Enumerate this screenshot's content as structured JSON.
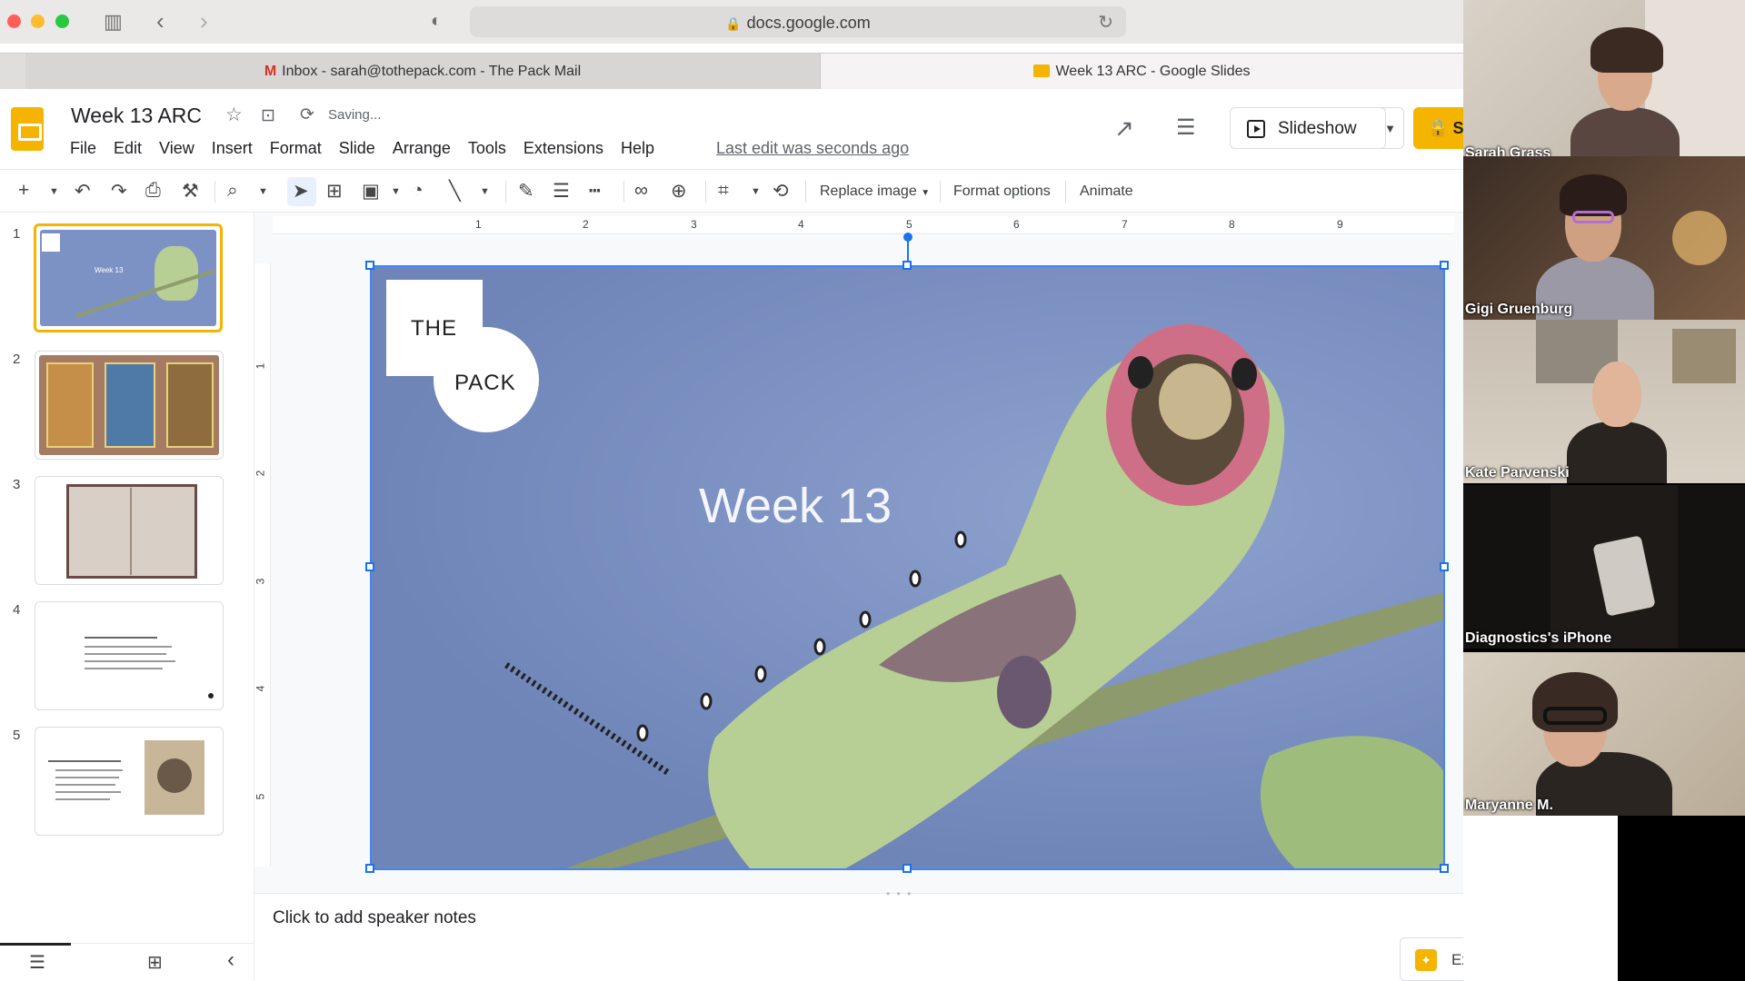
{
  "browser": {
    "url": "docs.google.com",
    "tabs": [
      {
        "label": "Inbox - sarah@tothepack.com - The Pack Mail"
      },
      {
        "label": "Week 13 ARC - Google Slides"
      }
    ],
    "side_badge": "M"
  },
  "doc": {
    "title": "Week 13 ARC",
    "status": "Saving...",
    "last_edit": "Last edit was seconds ago",
    "menu": [
      "File",
      "Edit",
      "View",
      "Insert",
      "Format",
      "Slide",
      "Arrange",
      "Tools",
      "Extensions",
      "Help"
    ],
    "slideshow_label": "Slideshow",
    "share_label": "S"
  },
  "toolbar": {
    "replace_image": "Replace image",
    "format_options": "Format options",
    "animate": "Animate"
  },
  "filmstrip": {
    "slides": [
      {
        "num": "1",
        "thumb_text": "Week 13"
      },
      {
        "num": "2"
      },
      {
        "num": "3"
      },
      {
        "num": "4"
      },
      {
        "num": "5"
      }
    ]
  },
  "ruler": {
    "top": [
      "1",
      "2",
      "3",
      "4",
      "5",
      "6",
      "7",
      "8",
      "9"
    ],
    "left": [
      "1",
      "2",
      "3",
      "4",
      "5"
    ]
  },
  "slide": {
    "logo_the": "THE",
    "logo_pack": "PACK",
    "title": "Week 13"
  },
  "notes": {
    "placeholder": "Click to add speaker notes"
  },
  "explore": {
    "label": "Explore"
  },
  "participants": [
    {
      "name": "Sarah Grass"
    },
    {
      "name": "Gigi Gruenburg"
    },
    {
      "name": "Kate Parvenski"
    },
    {
      "name": "Diagnostics's iPhone"
    },
    {
      "name": "Maryanne M."
    }
  ],
  "colors": {
    "accent_yellow": "#f4b400",
    "selection_blue": "#1a73e8",
    "slide_sky": "#7a8fc1",
    "caterpillar_green": "#b7cf94"
  }
}
